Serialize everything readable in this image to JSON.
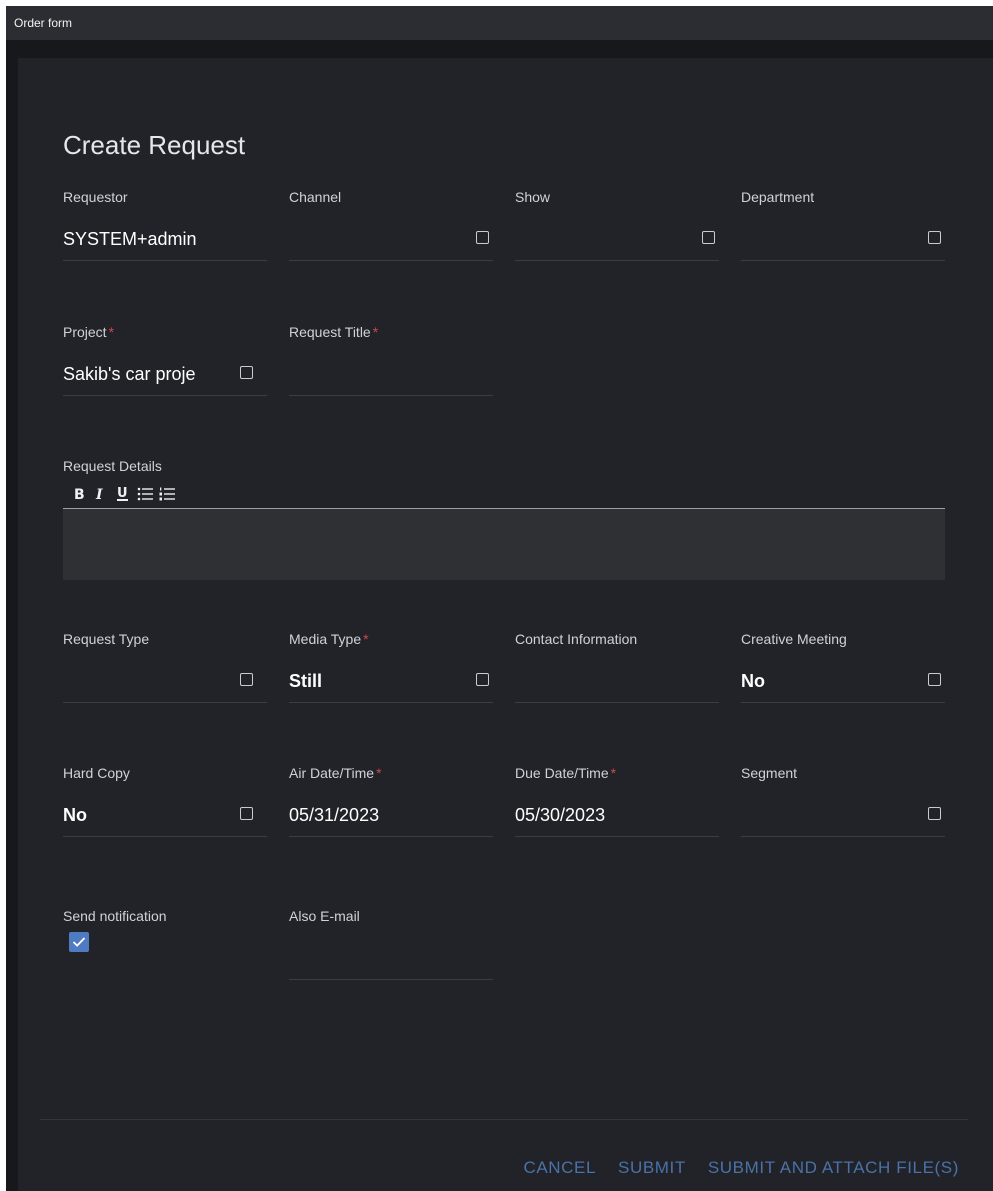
{
  "window": {
    "title": "Order form"
  },
  "form": {
    "heading": "Create Request",
    "fields": {
      "requestor": {
        "label": "Requestor",
        "value": "SYSTEM+admin",
        "required": false
      },
      "channel": {
        "label": "Channel",
        "value": "",
        "required": false
      },
      "show": {
        "label": "Show",
        "value": "",
        "required": false
      },
      "department": {
        "label": "Department",
        "value": "",
        "required": false
      },
      "project": {
        "label": "Project",
        "value": "Sakib's car proje",
        "required": true
      },
      "request_title": {
        "label": "Request Title",
        "value": "",
        "required": true
      },
      "request_type": {
        "label": "Request Type",
        "value": "",
        "required": false
      },
      "media_type": {
        "label": "Media Type",
        "value": "Still",
        "required": true
      },
      "contact_information": {
        "label": "Contact Information",
        "value": "",
        "required": false
      },
      "creative_meeting": {
        "label": "Creative Meeting",
        "value": "No",
        "required": false
      },
      "hard_copy": {
        "label": "Hard Copy",
        "value": "No",
        "required": false
      },
      "air_date_time": {
        "label": "Air Date/Time",
        "value": "05/31/2023",
        "required": true
      },
      "due_date_time": {
        "label": "Due Date/Time",
        "value": "05/30/2023",
        "required": true
      },
      "segment": {
        "label": "Segment",
        "value": "",
        "required": false
      },
      "also_email": {
        "label": "Also E-mail",
        "value": "",
        "required": false
      }
    },
    "request_details": {
      "label": "Request Details",
      "toolbar": [
        "bold",
        "italic",
        "underline",
        "bulleted-list",
        "numbered-list"
      ],
      "value": ""
    },
    "send_notification": {
      "label": "Send notification",
      "checked": true
    },
    "required_marker": "*"
  },
  "actions": {
    "cancel": "CANCEL",
    "submit": "SUBMIT",
    "submit_attach": "SUBMIT AND ATTACH FILE(S)"
  },
  "colors": {
    "background": "#212328",
    "accent": "#4a72a8",
    "required": "#d04848",
    "checkbox": "#4f7bc2"
  }
}
